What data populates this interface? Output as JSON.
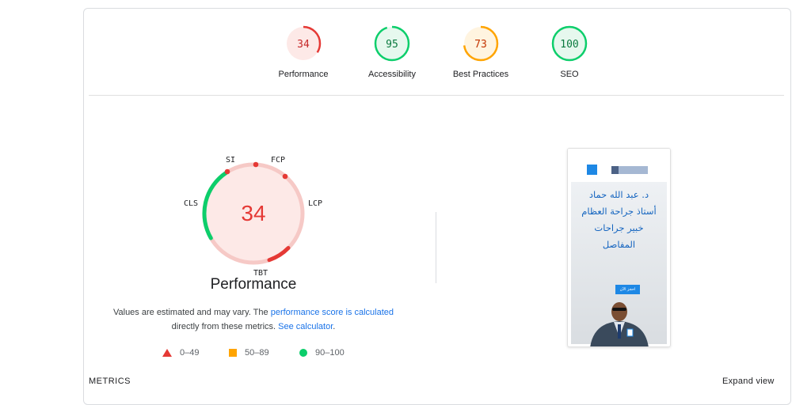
{
  "scores": [
    {
      "label": "Performance",
      "value": 34,
      "color": "#e53935",
      "bg": "#fde9e7"
    },
    {
      "label": "Accessibility",
      "value": 95,
      "color": "#0cce6b",
      "bg": "#e6f8ee"
    },
    {
      "label": "Best Practices",
      "value": 73,
      "color": "#ffa400",
      "bg": "#fff4e0"
    },
    {
      "label": "SEO",
      "value": 100,
      "color": "#0cce6b",
      "bg": "#e6f8ee"
    }
  ],
  "main": {
    "score": "34",
    "title": "Performance",
    "metric_labels": {
      "si": "SI",
      "fcp": "FCP",
      "lcp": "LCP",
      "tbt": "TBT",
      "cls": "CLS"
    },
    "note_pre": "Values are estimated and may vary. The ",
    "note_link1": "performance score is calculated",
    "note_mid": "directly from these metrics. ",
    "note_link2": "See calculator",
    "note_end": "."
  },
  "legend": {
    "fail": "0–49",
    "average": "50–89",
    "pass": "90–100"
  },
  "metrics_heading": "METRICS",
  "expand_view": "Expand view",
  "screenshot": {
    "heading": "د. عبد الله حماد\nأستاذ جراحة العظام\nخبير جراحات\nالمفاصل",
    "button": "احجز الآن"
  },
  "colors": {
    "fail": "#e53935",
    "average": "#ffa400",
    "pass": "#0cce6b",
    "link": "#1a73e8"
  }
}
